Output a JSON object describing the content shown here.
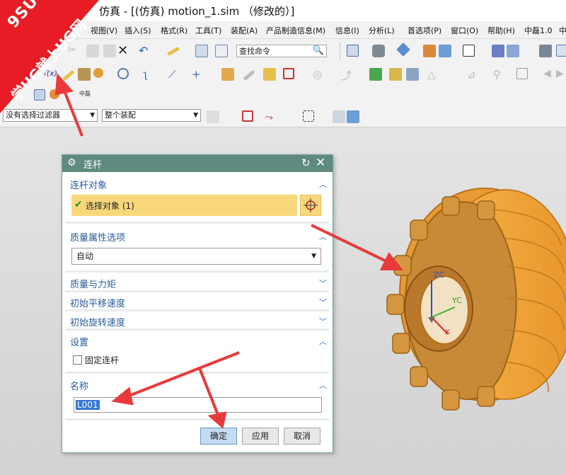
{
  "app": {
    "title_suffix": "仿真 - [(仿真) motion_1.sim （修改的）]"
  },
  "watermark": {
    "line1": "9SUG",
    "line2": "学UG就上UG网"
  },
  "menu": {
    "items": [
      "视图(V)",
      "插入(S)",
      "格式(R)",
      "工具(T)",
      "装配(A)",
      "产品制造信息(M)",
      "信息(I)",
      "分析(L)",
      "首选项(P)",
      "窗口(O)",
      "帮助(H)",
      "中磊1.0",
      "中"
    ]
  },
  "toolbar": {
    "search_placeholder": "查找命令",
    "fx_label": "f(x)",
    "mini_label": "中磊"
  },
  "filterbar": {
    "selection_filter": "没有选择过滤器",
    "scope": "整个装配"
  },
  "dialog": {
    "title": "连杆",
    "sections": {
      "link_object": {
        "title": "连杆对象",
        "select_label": "选择对象 (1)"
      },
      "mass_options": {
        "title": "质量属性选项",
        "value": "自动"
      },
      "mass_moment": {
        "title": "质量与力矩"
      },
      "init_trans": {
        "title": "初始平移速度"
      },
      "init_rot": {
        "title": "初始旋转速度"
      },
      "settings": {
        "title": "设置",
        "fix_link_label": "固定连杆"
      },
      "name": {
        "title": "名称",
        "value": "L001"
      }
    },
    "buttons": {
      "ok": "确定",
      "apply": "应用",
      "cancel": "取消"
    }
  },
  "viewport": {
    "axes": {
      "zc": "ZC",
      "yc": "YC",
      "xc": "X"
    }
  },
  "colors": {
    "dialog_header": "#5e8a7f",
    "selection_highlight": "#f9d87c",
    "gear_orange": "#f0a030",
    "accent_blue": "#2a5c9a",
    "arrow_red": "#e83a3a"
  }
}
